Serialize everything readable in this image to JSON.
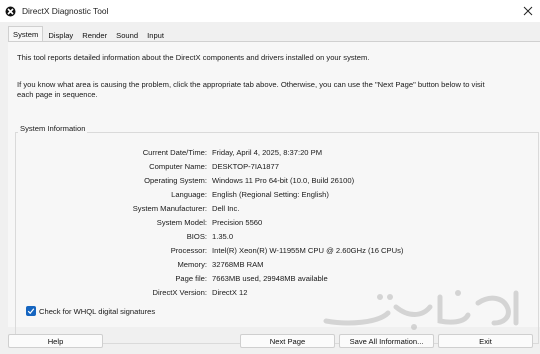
{
  "window": {
    "title": "DirectX Diagnostic Tool"
  },
  "tabs": [
    {
      "label": "System"
    },
    {
      "label": "Display"
    },
    {
      "label": "Render"
    },
    {
      "label": "Sound"
    },
    {
      "label": "Input"
    }
  ],
  "intro": {
    "line1": "This tool reports detailed information about the DirectX components and drivers installed on your system.",
    "line2": "If you know what area is causing the problem, click the appropriate tab above.  Otherwise, you can use the \"Next Page\" button below to visit",
    "line3": "each page in sequence."
  },
  "system_info": {
    "group_title": "System Information",
    "rows": [
      {
        "label": "Current Date/Time:",
        "value": "Friday, April 4, 2025, 8:37:20 PM"
      },
      {
        "label": "Computer Name:",
        "value": "DESKTOP-7IA1877"
      },
      {
        "label": "Operating System:",
        "value": "Windows 11 Pro 64-bit (10.0, Build 26100)"
      },
      {
        "label": "Language:",
        "value": "English (Regional Setting: English)"
      },
      {
        "label": "System Manufacturer:",
        "value": "Dell Inc."
      },
      {
        "label": "System Model:",
        "value": "Precision 5560"
      },
      {
        "label": "BIOS:",
        "value": "1.35.0"
      },
      {
        "label": "Processor:",
        "value": "Intel(R) Xeon(R) W-11955M CPU @ 2.60GHz (16 CPUs)"
      },
      {
        "label": "Memory:",
        "value": "32768MB RAM"
      },
      {
        "label": "Page file:",
        "value": "7663MB used, 29948MB available"
      },
      {
        "label": "DirectX Version:",
        "value": "DirectX 12"
      }
    ]
  },
  "whql": {
    "label": "Check for WHQL digital signatures",
    "checked": true
  },
  "buttons": {
    "help": "Help",
    "next_page": "Next Page",
    "save_all": "Save All Information...",
    "exit": "Exit"
  },
  "colors": {
    "accent": "#1565c0",
    "panel": "#f7f7f7",
    "window": "#f0f0f0"
  }
}
